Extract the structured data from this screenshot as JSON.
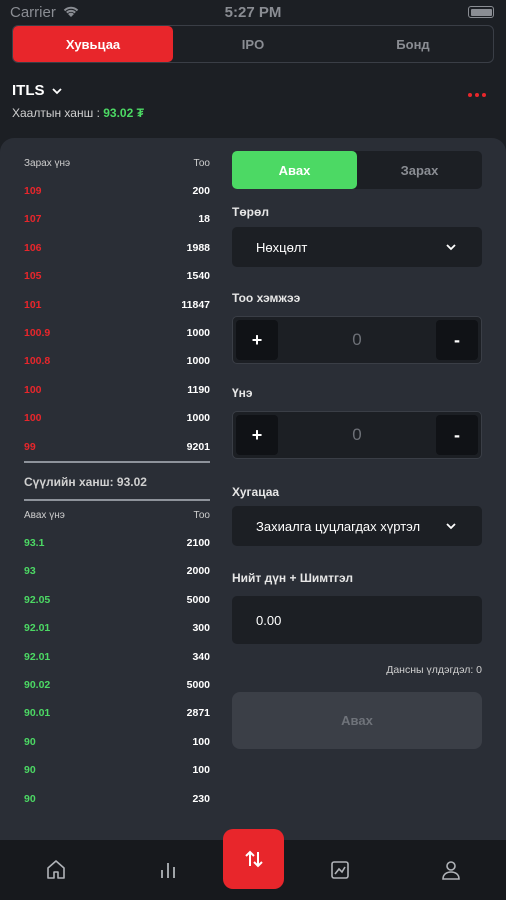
{
  "status": {
    "carrier": "Carrier",
    "time": "5:27 PM"
  },
  "tabs": [
    {
      "label": "Хувьцаа",
      "active": true
    },
    {
      "label": "IPO",
      "active": false
    },
    {
      "label": "Бонд",
      "active": false
    }
  ],
  "instrument": {
    "symbol": "ITLS",
    "close_label": "Хаалтын ханш :",
    "close_value": "93.02 ₮"
  },
  "order_book": {
    "sell_header": {
      "price": "Зарах үнэ",
      "qty": "Тоо"
    },
    "sells": [
      {
        "price": "109",
        "qty": "200"
      },
      {
        "price": "107",
        "qty": "18"
      },
      {
        "price": "106",
        "qty": "1988"
      },
      {
        "price": "105",
        "qty": "1540"
      },
      {
        "price": "101",
        "qty": "11847"
      },
      {
        "price": "100.9",
        "qty": "1000"
      },
      {
        "price": "100.8",
        "qty": "1000"
      },
      {
        "price": "100",
        "qty": "1190"
      },
      {
        "price": "100",
        "qty": "1000"
      },
      {
        "price": "99",
        "qty": "9201"
      }
    ],
    "last_price": "Сүүлийн ханш: 93.02",
    "buy_header": {
      "price": "Авах үнэ",
      "qty": "Тоо"
    },
    "buys": [
      {
        "price": "93.1",
        "qty": "2100"
      },
      {
        "price": "93",
        "qty": "2000"
      },
      {
        "price": "92.05",
        "qty": "5000"
      },
      {
        "price": "92.01",
        "qty": "300"
      },
      {
        "price": "92.01",
        "qty": "340"
      },
      {
        "price": "90.02",
        "qty": "5000"
      },
      {
        "price": "90.01",
        "qty": "2871"
      },
      {
        "price": "90",
        "qty": "100"
      },
      {
        "price": "90",
        "qty": "100"
      },
      {
        "price": "90",
        "qty": "230"
      }
    ]
  },
  "order_form": {
    "side_buy": "Авах",
    "side_sell": "Зарах",
    "type_label": "Төрөл",
    "type_value": "Нөхцөлт",
    "quantity_label": "Тоо хэмжээ",
    "quantity_value": "0",
    "price_label": "Үнэ",
    "price_value": "0",
    "plus": "+",
    "minus": "-",
    "duration_label": "Хугацаа",
    "duration_value": "Захиалга цуцлагдах хүртэл",
    "total_label": "Нийт дүн + Шимтгэл",
    "total_value": "0.00",
    "balance": "Дансны үлдэгдэл: 0",
    "submit": "Авах"
  },
  "colors": {
    "accent": "#e8262b",
    "buy": "#4cd964",
    "sell": "#e8262b",
    "background": "#1c1f24",
    "panel": "#2a2e36"
  },
  "nav": {
    "icons": [
      "home-icon",
      "chart-bars-icon",
      "swap-arrows-icon",
      "image-chart-icon",
      "user-icon"
    ]
  }
}
